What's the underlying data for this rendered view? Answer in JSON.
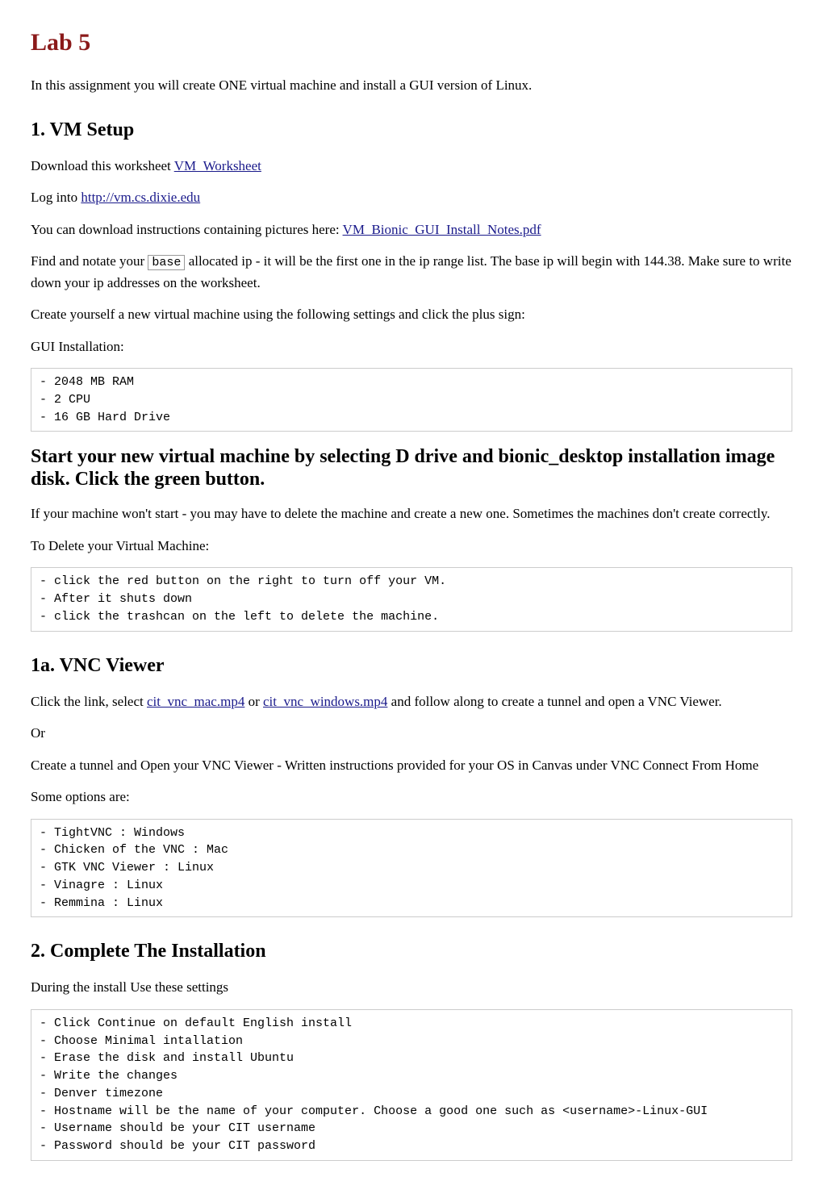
{
  "title": "Lab 5",
  "intro": "In this assignment you will create ONE virtual machine and install a GUI version of Linux.",
  "section1": {
    "heading": "1. VM Setup",
    "p1_pre": "Download this worksheet ",
    "p1_link": "VM_Worksheet",
    "p2_pre": "Log into ",
    "p2_link": "http://vm.cs.dixie.edu",
    "p3_pre": "You can download instructions containing pictures here: ",
    "p3_link": "VM_Bionic_GUI_Install_Notes.pdf",
    "p4_a": "Find and notate your ",
    "p4_code": "base",
    "p4_b": " allocated ip - it will be the first one in the ip range list. The base ip will begin with 144.38. Make sure to write down your ip addresses on the worksheet.",
    "p5": "Create yourself a new virtual machine using the following settings and click the plus sign:",
    "p6": "GUI Installation:",
    "code1": "- 2048 MB RAM\n- 2 CPU\n- 16 GB Hard Drive"
  },
  "start": {
    "heading": "Start your new virtual machine by selecting D drive and bionic_desktop installation image disk. Click the green button.",
    "p1": "If your machine won't start - you may have to delete the machine and create a new one. Sometimes the machines don't create correctly.",
    "p2": "To Delete your Virtual Machine:",
    "code": "- click the red button on the right to turn off your VM.\n- After it shuts down\n- click the trashcan on the left to delete the machine."
  },
  "section1a": {
    "heading": "1a. VNC Viewer",
    "p1_a": "Click the link, select ",
    "p1_link1": "cit_vnc_mac.mp4",
    "p1_mid": " or ",
    "p1_link2": "cit_vnc_windows.mp4",
    "p1_b": " and follow along to create a tunnel and open a VNC Viewer.",
    "p2": "Or",
    "p3": "Create a tunnel and Open your VNC Viewer - Written instructions provided for your OS in Canvas under VNC Connect From Home",
    "p4": "Some options are:",
    "code": "- TightVNC : Windows\n- Chicken of the VNC : Mac\n- GTK VNC Viewer : Linux\n- Vinagre : Linux\n- Remmina : Linux"
  },
  "section2": {
    "heading": "2. Complete The Installation",
    "p1": "During the install Use these settings",
    "code": "- Click Continue on default English install\n- Choose Minimal intallation\n- Erase the disk and install Ubuntu\n- Write the changes\n- Denver timezone\n- Hostname will be the name of your computer. Choose a good one such as <username>-Linux-GUI\n- Username should be your CIT username\n- Password should be your CIT password"
  }
}
